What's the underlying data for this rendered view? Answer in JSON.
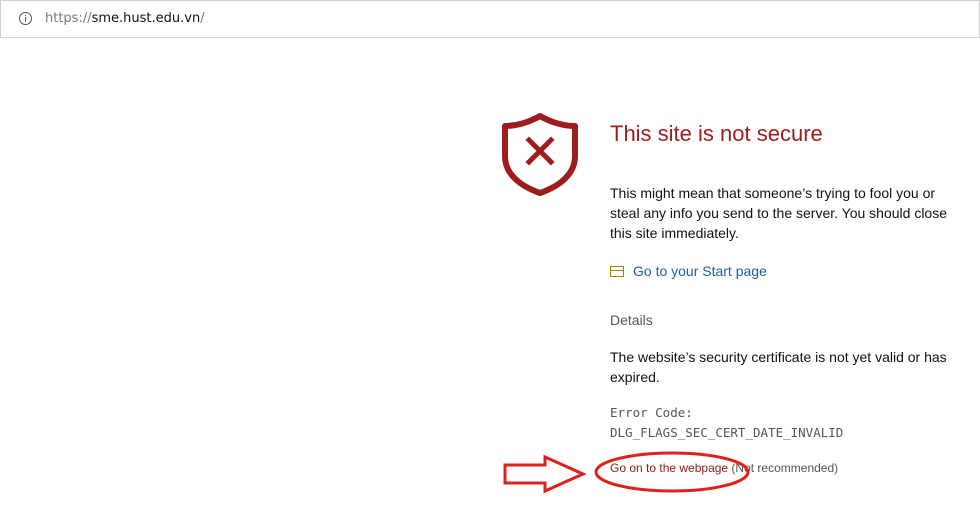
{
  "address_bar": {
    "scheme": "https://",
    "host": "sme.hust.edu.vn",
    "path": "/",
    "icon": "info-icon"
  },
  "error_page": {
    "icon": "shield-x-icon",
    "title": "This site is not secure",
    "description": "This might mean that someone’s trying to fool you or steal any info you send to the server. You should close this site immediately.",
    "start_link": {
      "icon": "start-page-icon",
      "label": "Go to your Start page"
    },
    "details_label": "Details",
    "cert_message": "The website’s security certificate is not yet valid or has expired.",
    "error_code_label": "Error Code:",
    "error_code": "DLG_FLAGS_SEC_CERT_DATE_INVALID",
    "proceed_link": "Go on to the webpage",
    "proceed_note": " (Not recommended)"
  },
  "colors": {
    "title_red": "#9d1d1d",
    "link_blue": "#1f5f9f",
    "annotation_red": "#e0201c"
  }
}
